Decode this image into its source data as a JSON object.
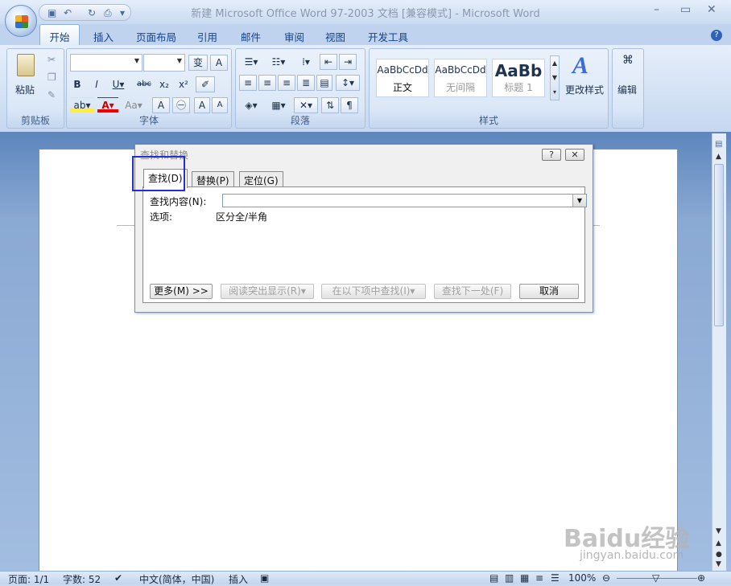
{
  "window": {
    "title": "新建 Microsoft Office Word 97-2003 文档 [兼容模式] - Microsoft Word"
  },
  "tabs": [
    "开始",
    "插入",
    "页面布局",
    "引用",
    "邮件",
    "审阅",
    "视图",
    "开发工具"
  ],
  "ribbon": {
    "clipboard": {
      "label": "剪贴板",
      "paste": "粘贴"
    },
    "font": {
      "label": "字体"
    },
    "paragraph": {
      "label": "段落"
    },
    "styles": {
      "label": "样式",
      "items": [
        {
          "preview": "AaBbCcDd",
          "name": "正文"
        },
        {
          "preview": "AaBbCcDd",
          "name": "无间隔"
        },
        {
          "preview": "AaBb",
          "name": "标题 1"
        }
      ],
      "change": "更改样式"
    },
    "editing": {
      "label": "编辑"
    }
  },
  "dialog": {
    "title": "查找和替换",
    "tabs": [
      "查找(D)",
      "替换(P)",
      "定位(G)"
    ],
    "find_label": "查找内容(N):",
    "find_value": "",
    "options_label": "选项:",
    "options_value": "区分全/半角",
    "buttons": {
      "more": "更多(M) >>",
      "reading": "阅读突出显示(R)▾",
      "find_in": "在以下项中查找(I)▾",
      "find_next": "查找下一处(F)",
      "cancel": "取消"
    }
  },
  "status": {
    "page": "页面: 1/1",
    "words": "字数: 52",
    "lang": "中文(简体，中国)",
    "mode": "插入",
    "zoom": "100%"
  },
  "watermark": {
    "brand": "Baidu经验",
    "url": "jingyan.baidu.com"
  }
}
